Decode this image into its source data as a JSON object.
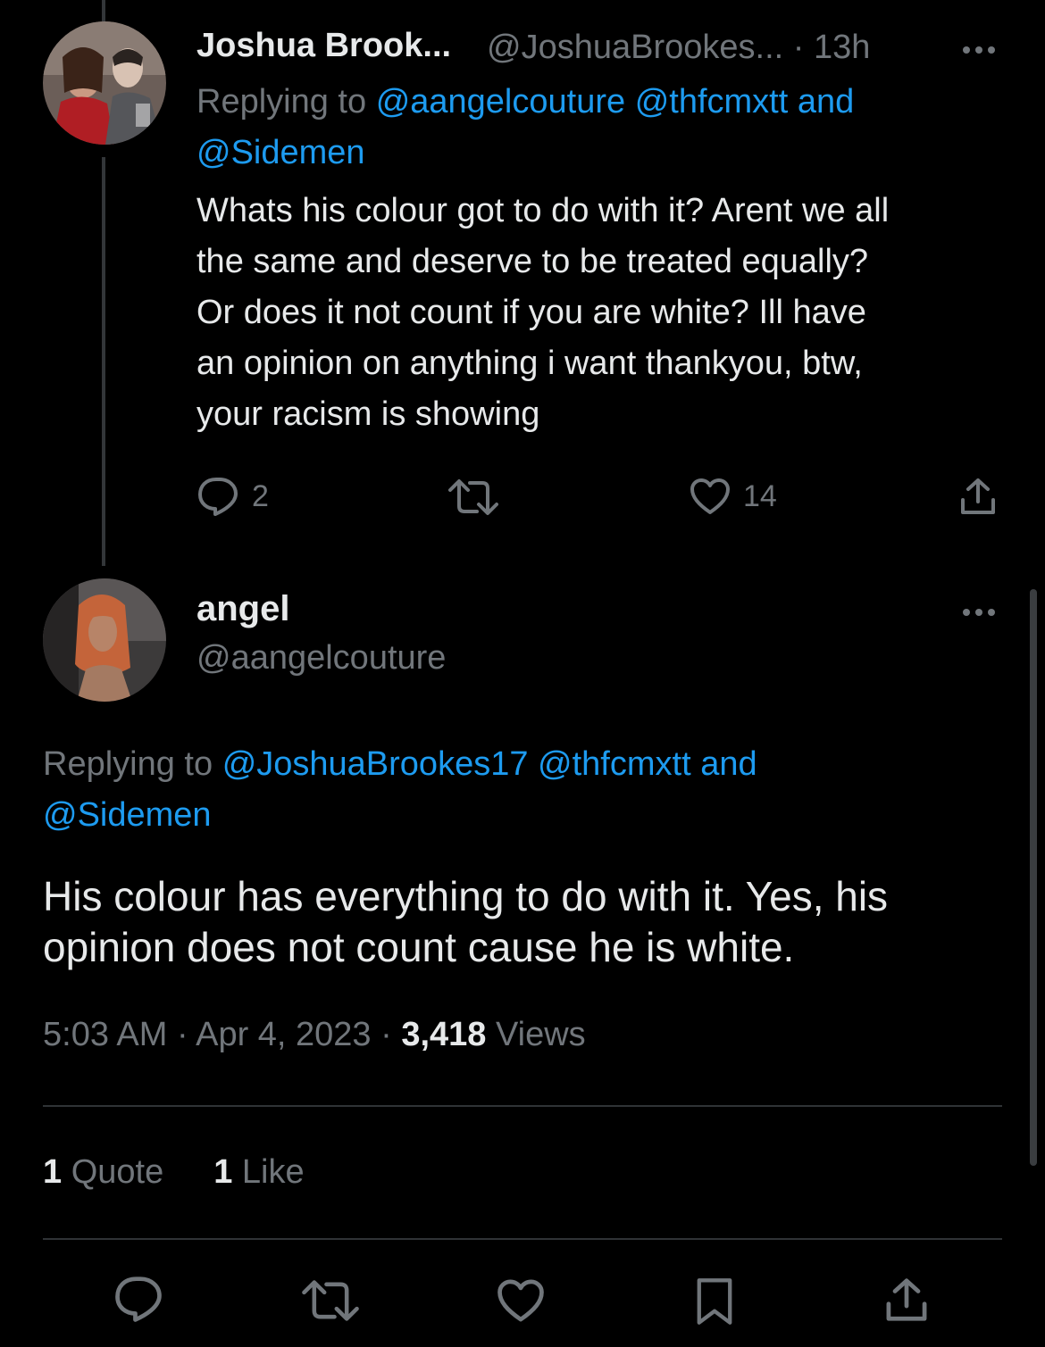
{
  "tweet1": {
    "display_name": "Joshua Brook...",
    "handle_time": "@JoshuaBrookes... · 13h",
    "replying_prefix": "Replying to",
    "replying_mentions": [
      "@aangelcouture",
      "@thfcmxtt"
    ],
    "replying_and": "and",
    "replying_last": "@Sidemen",
    "body": "Whats his colour got to do with it? Arent we all\nthe same and deserve to be treated equally?\nOr does it not count if you are white? Ill have\nan opinion on anything i want thankyou, btw,\nyour racism is showing",
    "reply_count": "2",
    "retweet_count": "",
    "like_count": "14"
  },
  "tweet2": {
    "display_name": "angel",
    "handle": "@aangelcouture",
    "replying_prefix": "Replying to",
    "replying_mentions": [
      "@JoshuaBrookes17",
      "@thfcmxtt"
    ],
    "replying_and": "and",
    "replying_last": "@Sidemen",
    "body": "His colour has everything to do with it. Yes, his opinion does not count cause he is white.",
    "time": "5:03 AM · Apr 4, 2023 · ",
    "views_count": "3,418",
    "views_label": " Views",
    "quote_count": "1",
    "quote_label": " Quote",
    "like_count": "1",
    "like_label": " Like"
  },
  "colors": {
    "background": "#000000",
    "text_primary": "#e7e9ea",
    "text_secondary": "#71767b",
    "link": "#1d9bf0",
    "divider": "#2f3336"
  },
  "icons": {
    "reply": "comment-bubble-icon",
    "retweet": "retweet-icon",
    "like": "heart-icon",
    "share": "share-icon",
    "bookmark": "bookmark-icon",
    "more": "more-dots-icon"
  }
}
